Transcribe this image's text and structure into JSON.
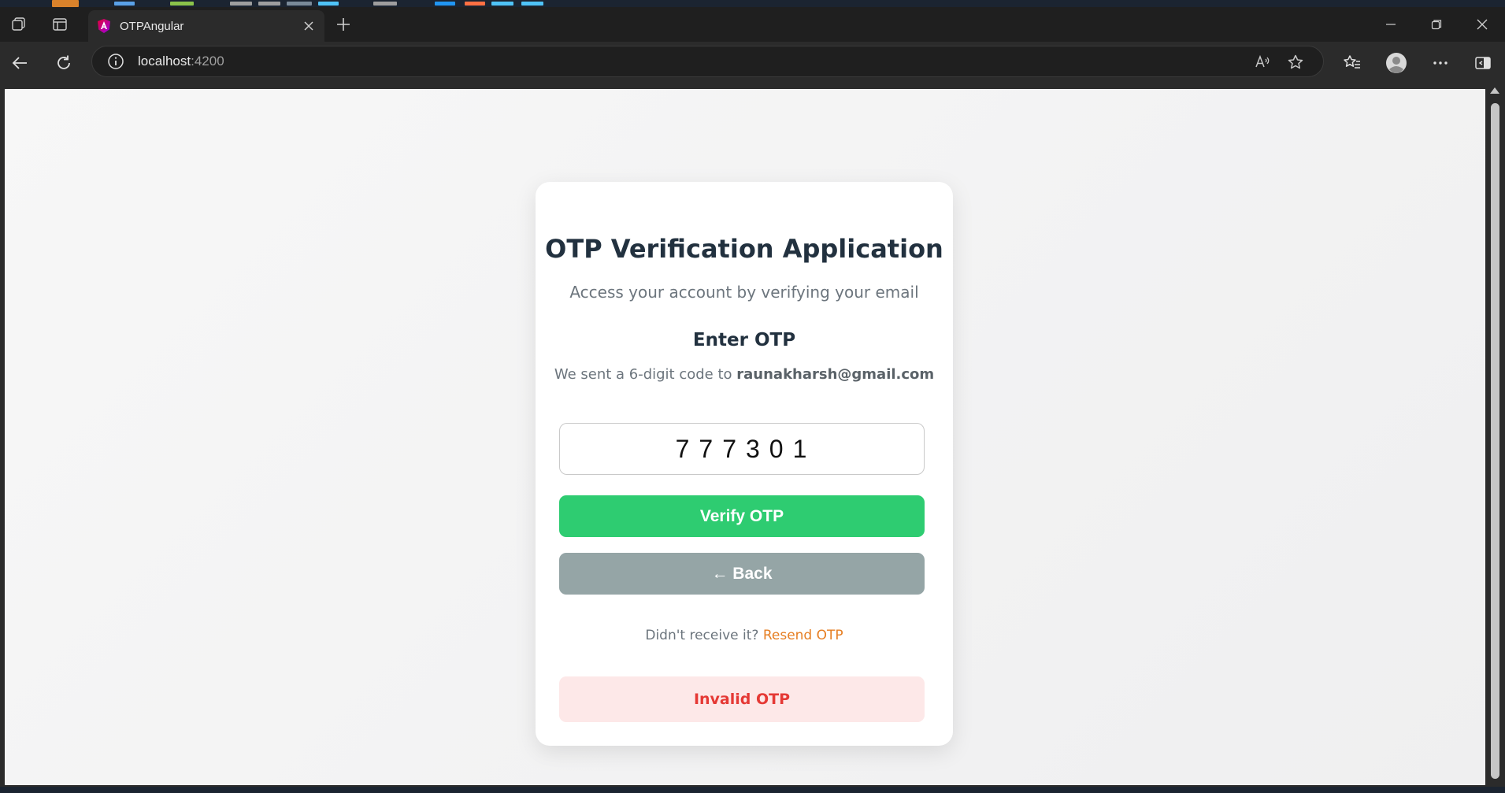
{
  "browser": {
    "tab_title": "OTPAngular",
    "url_host": "localhost",
    "url_port": ":4200",
    "icons": {
      "workspaces": "workspaces-icon",
      "tab_actions": "tab-actions-icon",
      "favicon": "angular-favicon-icon",
      "close_tab": "close-icon",
      "new_tab": "plus-icon",
      "minimize": "minimize-icon",
      "restore": "restore-icon",
      "close_window": "close-window-icon",
      "back": "back-arrow-icon",
      "reload": "reload-icon",
      "site_info": "info-icon",
      "read_aloud": "read-aloud-icon",
      "favorite": "star-icon",
      "favorites": "favorites-icon",
      "profile": "profile-icon",
      "more": "more-icon",
      "sidebar": "sidebar-icon"
    }
  },
  "card": {
    "title": "OTP Verification Application",
    "subtitle": "Access your account by verifying your email",
    "section_heading": "Enter OTP",
    "sent_prefix": "We sent a 6-digit code to ",
    "email": "raunakharsh@gmail.com",
    "otp_value": "777301",
    "verify_label": "Verify OTP",
    "back_label": "← Back",
    "resend_prompt": "Didn't receive it? ",
    "resend_link": "Resend OTP",
    "error_message": "Invalid OTP"
  },
  "colors": {
    "verify": "#2ecc71",
    "back": "#95a5a6",
    "link": "#e67e22",
    "error_text": "#e53935",
    "error_bg": "#fde8e8"
  }
}
